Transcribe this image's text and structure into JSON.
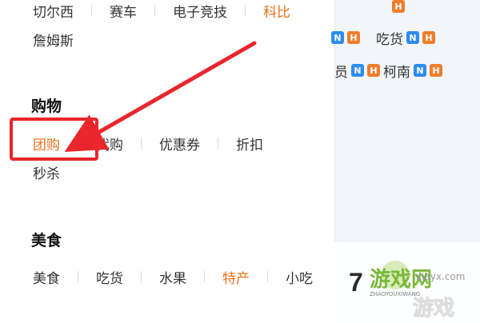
{
  "top_row": [
    {
      "label": "切尔西",
      "hot": false
    },
    {
      "label": "赛车",
      "hot": false
    },
    {
      "label": "电子竞技",
      "hot": false
    },
    {
      "label": "科比",
      "hot": true
    }
  ],
  "second_row": [
    {
      "label": "詹姆斯",
      "hot": false
    }
  ],
  "shopping": {
    "heading": "购物",
    "row1": [
      {
        "label": "团购",
        "hot": true
      },
      {
        "label": "代购",
        "hot": false
      },
      {
        "label": "优惠券",
        "hot": false
      },
      {
        "label": "折扣",
        "hot": false
      }
    ],
    "row2": [
      {
        "label": "秒杀",
        "hot": false
      }
    ]
  },
  "food": {
    "heading": "美食",
    "row1": [
      {
        "label": "美食",
        "hot": false
      },
      {
        "label": "吃货",
        "hot": false
      },
      {
        "label": "水果",
        "hot": false
      },
      {
        "label": "特产",
        "hot": true
      },
      {
        "label": "小吃",
        "hot": false
      }
    ]
  },
  "side": {
    "badge_n": "N",
    "badge_h": "H",
    "item_chihuo": "吃货",
    "item_yuan": "员",
    "item_kenan": "柯南"
  },
  "watermark": {
    "brand": "7号游戏网",
    "brand_num": "7",
    "brand_word": "游戏网",
    "sub": "ZHAOYOUXIWANG",
    "big": "游戏",
    "url": "xiayx.com"
  },
  "colors": {
    "accent_orange": "#e8721a",
    "highlight_red": "#e8262b",
    "badge_blue": "#2d8cf0",
    "badge_orange": "#f07d2a"
  }
}
